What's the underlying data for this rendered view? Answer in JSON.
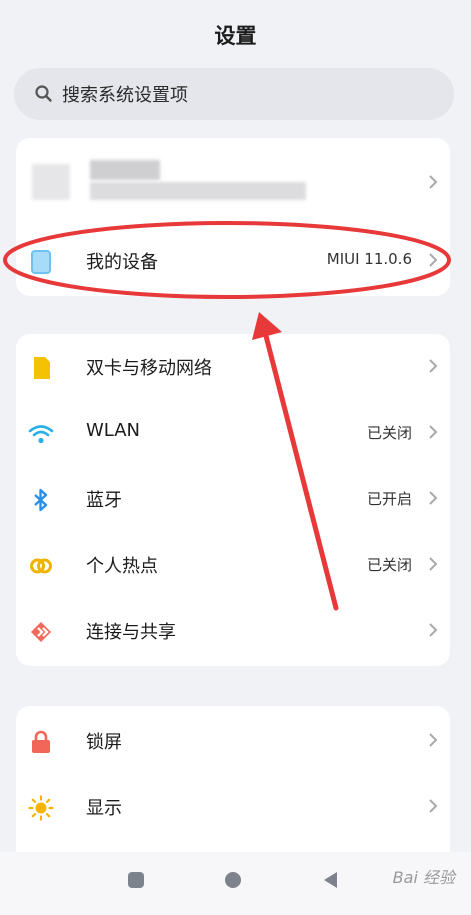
{
  "header": {
    "title": "设置"
  },
  "search": {
    "placeholder": "搜索系统设置项"
  },
  "account_card": {
    "my_device": {
      "label": "我的设备",
      "value": "MIUI 11.0.6"
    }
  },
  "network_card": {
    "items": [
      {
        "label": "双卡与移动网络",
        "value": "",
        "icon": "sim-card-icon"
      },
      {
        "label": "WLAN",
        "value": "已关闭",
        "icon": "wifi-icon"
      },
      {
        "label": "蓝牙",
        "value": "已开启",
        "icon": "bluetooth-icon"
      },
      {
        "label": "个人热点",
        "value": "已关闭",
        "icon": "hotspot-icon"
      },
      {
        "label": "连接与共享",
        "value": "",
        "icon": "share-icon"
      }
    ]
  },
  "display_card": {
    "items": [
      {
        "label": "锁屏",
        "icon": "lock-icon"
      },
      {
        "label": "显示",
        "icon": "sun-icon"
      }
    ]
  },
  "navbar": {
    "watermark": "Bai 经验"
  },
  "colors": {
    "annotation_red": "#e8393a",
    "sim_yellow": "#f4c200",
    "wifi_cyan": "#29b0e8",
    "bluetooth_blue": "#2a8fe6",
    "hotspot_yellow": "#f0b400",
    "share_red": "#f06a5a",
    "lock_red": "#f2665a",
    "sun_yellow": "#f5b400",
    "device_blue": "#6cc3f0"
  }
}
